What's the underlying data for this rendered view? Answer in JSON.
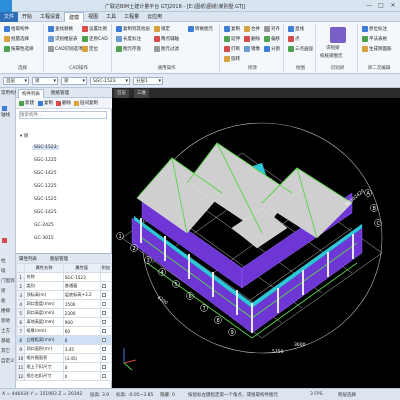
{
  "window": {
    "title": "广联达BIM土建计量平台 GTJ2018 - [E:\\图纸\\图纸\\某别墅.GTJ]",
    "controls": [
      "—",
      "□",
      "✕"
    ]
  },
  "menu": {
    "tabs": [
      {
        "label": "文件",
        "active": false,
        "file": true
      },
      {
        "label": "开始",
        "active": false
      },
      {
        "label": "工程设置",
        "active": false
      },
      {
        "label": "建模",
        "active": true
      },
      {
        "label": "视图",
        "active": false
      },
      {
        "label": "工具",
        "active": false
      },
      {
        "label": "工程量",
        "active": false
      },
      {
        "label": "云应用",
        "active": false
      }
    ]
  },
  "ribbon": {
    "groups": [
      {
        "label": "选择",
        "buttons": [
          "拾取构件",
          "批量选择",
          "按属性选择"
        ]
      },
      {
        "label": "CAD操作",
        "buttons": [
          "查找替换",
          "识别楼层表",
          "CAD识别选项",
          "设置比例",
          "还原CAD",
          "定位"
        ]
      },
      {
        "label": "通用操作",
        "buttons": [
          "复制到其他层",
          "长度标注",
          "图元存盘",
          "锁定",
          "两点辅轴",
          "图元过滤",
          "转换图元"
        ]
      },
      {
        "label": "修改",
        "buttons": [
          "复制",
          "延伸",
          "打断",
          "合并",
          "删除",
          "镜像",
          "对齐",
          "偏移",
          "分割",
          "旋转"
        ]
      },
      {
        "label": "绘图",
        "buttons": [
          "直线",
          "点",
          "三点画弧"
        ]
      },
      {
        "label": "识别梁",
        "buttons": [
          "识别梁",
          "校核梁图元",
          "编辑支座"
        ]
      },
      {
        "label": "梁二次编辑",
        "buttons": [
          "原位标注",
          "平法表格",
          "生成侧面筋"
        ]
      }
    ]
  },
  "toolstrip": {
    "floor": "首层",
    "category": "梁",
    "type": "梁",
    "element": "SGC-1523",
    "layer": "分层1"
  },
  "left_nav": {
    "items": [
      "常用构件",
      "轴线",
      "柱",
      "墙",
      "门窗洞",
      "梁",
      "板",
      "楼梯",
      "装修",
      "土方",
      "基础",
      "其它",
      "自定义"
    ]
  },
  "panel": {
    "tabs": [
      "构件列表",
      "图纸管理"
    ],
    "tools": [
      "新建",
      "复制",
      "删除",
      "层间复制"
    ],
    "search_placeholder": "搜索构件...",
    "tree_root": "梁",
    "items": [
      "SGC-1523",
      "SGC-1225",
      "SGC-1425",
      "SGC-1225",
      "SGC-1525",
      "SGC-1425",
      "GC-2425",
      "GC-3015"
    ],
    "selected_index": 0
  },
  "props": {
    "tabs": [
      "属性列表",
      "图层管理"
    ],
    "columns": [
      "属性名称",
      "属性值",
      "附加"
    ],
    "rows": [
      {
        "n": "1",
        "name": "名称",
        "value": "SGC-1523"
      },
      {
        "n": "2",
        "name": "类别",
        "value": "普通窗"
      },
      {
        "n": "3",
        "name": "顶标高(m)",
        "value": "层底标高+3.2"
      },
      {
        "n": "4",
        "name": "洞口宽度(mm)",
        "value": "1500"
      },
      {
        "n": "5",
        "name": "洞口高度(mm)",
        "value": "2300"
      },
      {
        "n": "6",
        "name": "离地高度(mm)",
        "value": "900"
      },
      {
        "n": "7",
        "name": "框厚(mm)",
        "value": "60"
      },
      {
        "n": "8",
        "name": "立樘距离(mm)",
        "value": "0"
      },
      {
        "n": "9",
        "name": "洞口面积(m²)",
        "value": "3.45"
      },
      {
        "n": "10",
        "name": "框外围面积",
        "value": "(3.45)"
      },
      {
        "n": "11",
        "name": "框上下扣尺寸",
        "value": "0"
      },
      {
        "n": "12",
        "name": "框左右扣尺寸",
        "value": "0"
      }
    ],
    "highlight_index": 7
  },
  "viewport": {
    "tabs": [
      "首层",
      "三维"
    ],
    "grid_labels": [
      "1",
      "2",
      "3",
      "4",
      "5",
      "6",
      "7",
      "8",
      "9",
      "10",
      "11",
      "A",
      "B",
      "C",
      "D",
      "E",
      "F",
      "G"
    ],
    "dim_labels": [
      "42002420",
      "5750",
      "3600",
      "4200",
      "2100",
      "6300"
    ]
  },
  "status": {
    "coords": "X = 446434 Y = 151903 Z = 20342",
    "floor_height": "层高: 3.9",
    "elevation": "标高: -0.05~3.85",
    "hidden": "隐藏: 0",
    "hint": "按鼠标左键指定第一个角点，或拾取构件图元",
    "fps": "3 FPS",
    "mode": "跨层选择"
  },
  "colors": {
    "accent": "#2d6fb8",
    "ribbon_bg": "#f4f7fb",
    "viewport_bg": "#000000",
    "wall": "#6f36d6",
    "slab": "#2fc8d8",
    "beam": "#5ad24a",
    "column": "#d8d8d8"
  }
}
